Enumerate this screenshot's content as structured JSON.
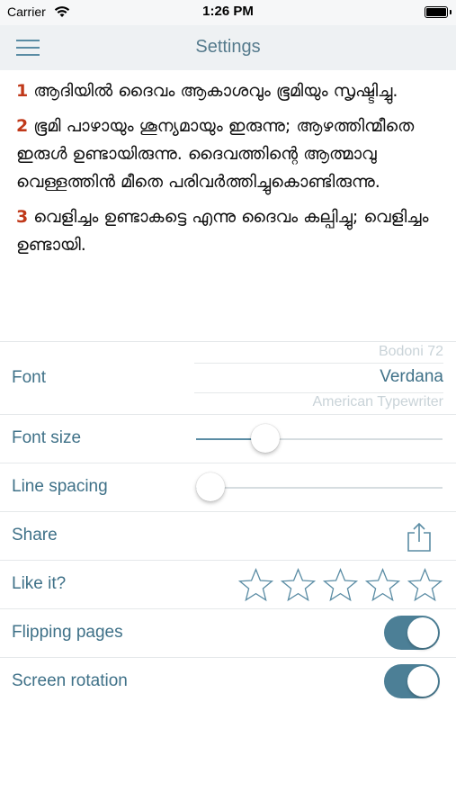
{
  "status_bar": {
    "carrier": "Carrier",
    "time": "1:26 PM",
    "icons": [
      "wifi-icon",
      "battery-icon"
    ]
  },
  "navbar": {
    "title": "Settings",
    "menu_icon": "hamburger-menu-icon"
  },
  "verses": [
    {
      "number": "1",
      "text": "ആദിയിൽ ദൈവം ആകാശവും ഭൂമിയും സൃഷ്ടിച്ചു."
    },
    {
      "number": "2",
      "text": "ഭൂമി പാഴായും ശൂന്യമായും ഇരുന്നു; ആഴത്തിന്മീതെ ഇരുൾ ഉണ്ടായിരുന്നു. ദൈവത്തിന്റെ ആത്മാവു വെള്ളത്തിൻ മീതെ പരിവർത്തിച്ചുകൊണ്ടിരുന്നു."
    },
    {
      "number": "3",
      "text": "വെളിച്ചം ഉണ്ടാകട്ടെ എന്നു ദൈവം കല്പിച്ചു; വെളിച്ചം ഉണ്ടായി."
    }
  ],
  "settings": {
    "font": {
      "label": "Font",
      "options_visible": [
        "Bodoni 72",
        "Verdana",
        "American Typewriter"
      ],
      "selected": "Verdana"
    },
    "font_size": {
      "label": "Font size",
      "value": 0.25
    },
    "line_spacing": {
      "label": "Line spacing",
      "value": 0.0
    },
    "share": {
      "label": "Share",
      "icon": "share-icon"
    },
    "like": {
      "label": "Like it?",
      "stars_total": 5,
      "stars_filled": 0,
      "icon": "star-icon"
    },
    "flipping_pages": {
      "label": "Flipping pages",
      "on": true
    },
    "screen_rotation": {
      "label": "Screen rotation",
      "on": true
    }
  },
  "colors": {
    "accent": "#4c7f96",
    "label": "#3f7188",
    "verse_number": "#c0391a",
    "navbar_bg": "#eef1f3"
  }
}
